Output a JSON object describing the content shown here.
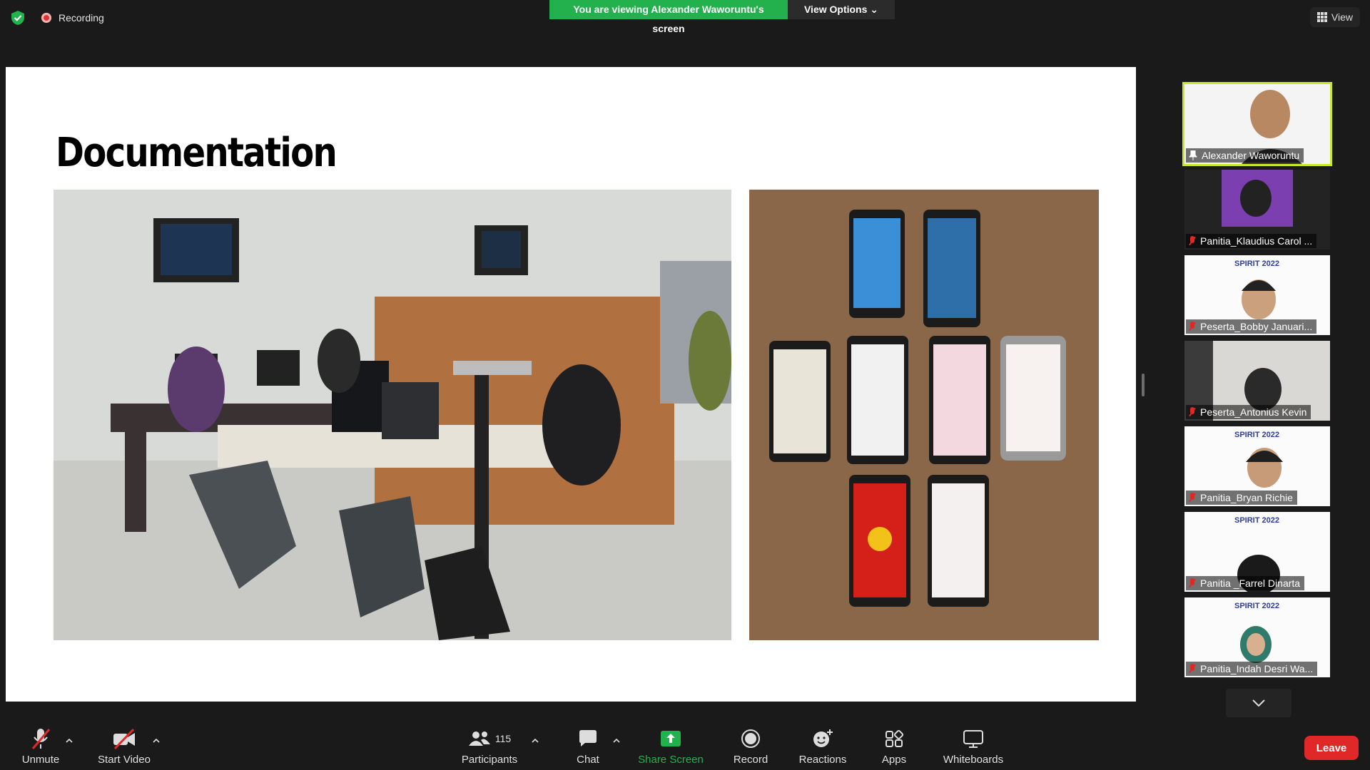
{
  "top_bar": {
    "recording_label": "Recording",
    "banner_text": "You are viewing Alexander Waworuntu's screen",
    "view_options_label": "View Options",
    "view_label": "View"
  },
  "slide": {
    "title": "Documentation"
  },
  "participants": [
    {
      "name": "Alexander Waworuntu",
      "active": true,
      "muted": false,
      "icon": "pin-icon"
    },
    {
      "name": "Panitia_Klaudius Carol ...",
      "muted": true
    },
    {
      "name": "Peserta_Bobby Januari...",
      "muted": true
    },
    {
      "name": "Peserta_Antonius Kevin",
      "muted": true
    },
    {
      "name": "Panitia_Bryan Richie",
      "muted": true
    },
    {
      "name": "Panitia _Farrel Dinarta",
      "muted": true
    },
    {
      "name": "Panitia_Indah Desri Wa...",
      "muted": true
    }
  ],
  "tile_badge": "SPIRIT 2022",
  "toolbar": {
    "unmute": "Unmute",
    "start_video": "Start Video",
    "participants": "Participants",
    "participants_count": "115",
    "chat": "Chat",
    "share_screen": "Share Screen",
    "record": "Record",
    "reactions": "Reactions",
    "apps": "Apps",
    "whiteboards": "Whiteboards",
    "leave": "Leave"
  },
  "colors": {
    "banner_green": "#23b14d",
    "share_green": "#23b14d",
    "leave_red": "#e02828",
    "active_speaker": "#c9e82a"
  }
}
